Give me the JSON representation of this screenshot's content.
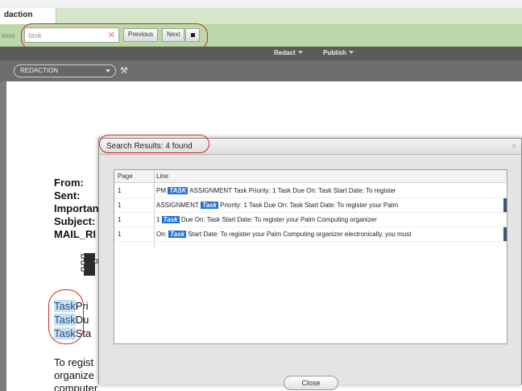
{
  "tab": {
    "label": "daction"
  },
  "findbar": {
    "cut_label": "tions",
    "query": "task",
    "previous_label": "Previous",
    "next_label": "Next"
  },
  "menus": {
    "redact": "Redact",
    "publish": "Publish"
  },
  "docbar": {
    "mode_value": "REDACTION"
  },
  "document": {
    "header_labels": [
      "From:",
      "Sent:",
      "Importan",
      "Subject:",
      "MAIL_RI"
    ],
    "task_lines": [
      {
        "word": "Task",
        "rest": "Pri"
      },
      {
        "word": "Task",
        "rest": "Du"
      },
      {
        "word": "Task",
        "rest": "Sta"
      }
    ],
    "body_lines": [
      "To regist",
      "organize",
      "computer"
    ]
  },
  "dialog": {
    "title": "Search Results: 4 found",
    "close_glyph": "×",
    "columns": {
      "page": "Page",
      "line": "Line"
    },
    "rows": [
      {
        "page": "1",
        "before": "PM ",
        "keyword": "TASK",
        "after": " ASSIGNMENT Task Priority: 1 Task Due On: Task Start Date: To register"
      },
      {
        "page": "1",
        "before": "ASSIGNMENT ",
        "keyword": "Task",
        "after": " Priority: 1 Task Due On: Task Start Date: To register your Palm"
      },
      {
        "page": "1",
        "before": "1 ",
        "keyword": "Task",
        "after": " Due On: Task Start Date: To register your Palm Computing organizer"
      },
      {
        "page": "1",
        "before": "On: ",
        "keyword": "Task",
        "after": " Start Date: To register your Palm Computing organizer electronically, you must"
      }
    ],
    "close_button": "Close"
  },
  "colors": {
    "findbar_bg": "#bdd8a8",
    "annotation_ring": "#cc2a22",
    "keyword_highlight": "#1f6fd6",
    "doc_highlight": "#c8def4"
  },
  "icons": {
    "clear": "close-icon",
    "stop": "stop-icon",
    "tool": "wrench-icon",
    "dialog_close": "close-icon"
  }
}
